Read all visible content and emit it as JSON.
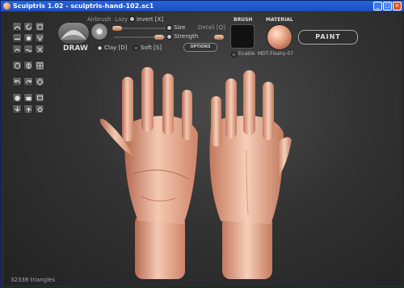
{
  "window": {
    "title": "Sculptris 1.02 - sculptris-hand-102.sc1",
    "min_glyph": "_",
    "max_glyph": "□",
    "close_glyph": "×",
    "titlebar_color": "#2a63d8",
    "close_color": "#d9542a"
  },
  "toolbar": {
    "draw_label": "DRAW",
    "airbrush_label": "Airbrush",
    "lazy_label": "Lazy",
    "invert_label": "Invert [X]",
    "size_label": "Size",
    "strength_label": "Strength",
    "detail_label": "Detail [Q]",
    "clay_label": "Clay [D]",
    "soft_label": "Soft [S]",
    "options_label": "OPTIONS",
    "brush_header": "BRUSH",
    "enable_label": "Enable",
    "material_header": "MATERIAL",
    "material_name": "MDT-Fleshy-07",
    "paint_label": "PAINT"
  },
  "status": {
    "triangles": "32338 triangles"
  },
  "colors": {
    "skin_light": "#f4c9b2",
    "skin_mid": "#e4a287",
    "skin_dark": "#b76a52",
    "slider_knob": "#d89a76"
  }
}
